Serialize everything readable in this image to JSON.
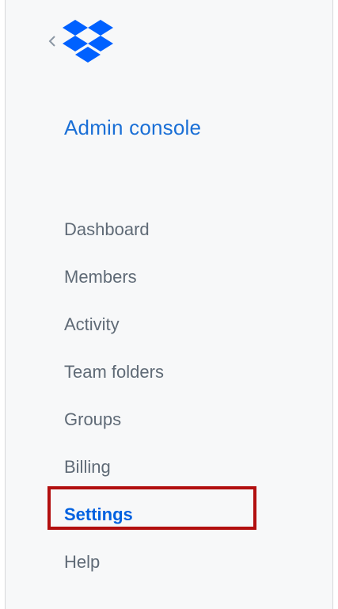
{
  "sidebar": {
    "back_icon": "chevron-left-icon",
    "logo_icon": "dropbox-logo-icon",
    "title": "Admin console",
    "items": [
      {
        "label": "Dashboard",
        "active": false
      },
      {
        "label": "Members",
        "active": false
      },
      {
        "label": "Activity",
        "active": false
      },
      {
        "label": "Team folders",
        "active": false
      },
      {
        "label": "Groups",
        "active": false
      },
      {
        "label": "Billing",
        "active": false
      },
      {
        "label": "Settings",
        "active": true
      },
      {
        "label": "Help",
        "active": false
      }
    ]
  },
  "colors": {
    "accent": "#0061e0",
    "title": "#1a6fd6",
    "nav_text": "#5f6a76",
    "highlight": "#b20f0f",
    "sidebar_bg": "#f7f8f9"
  }
}
